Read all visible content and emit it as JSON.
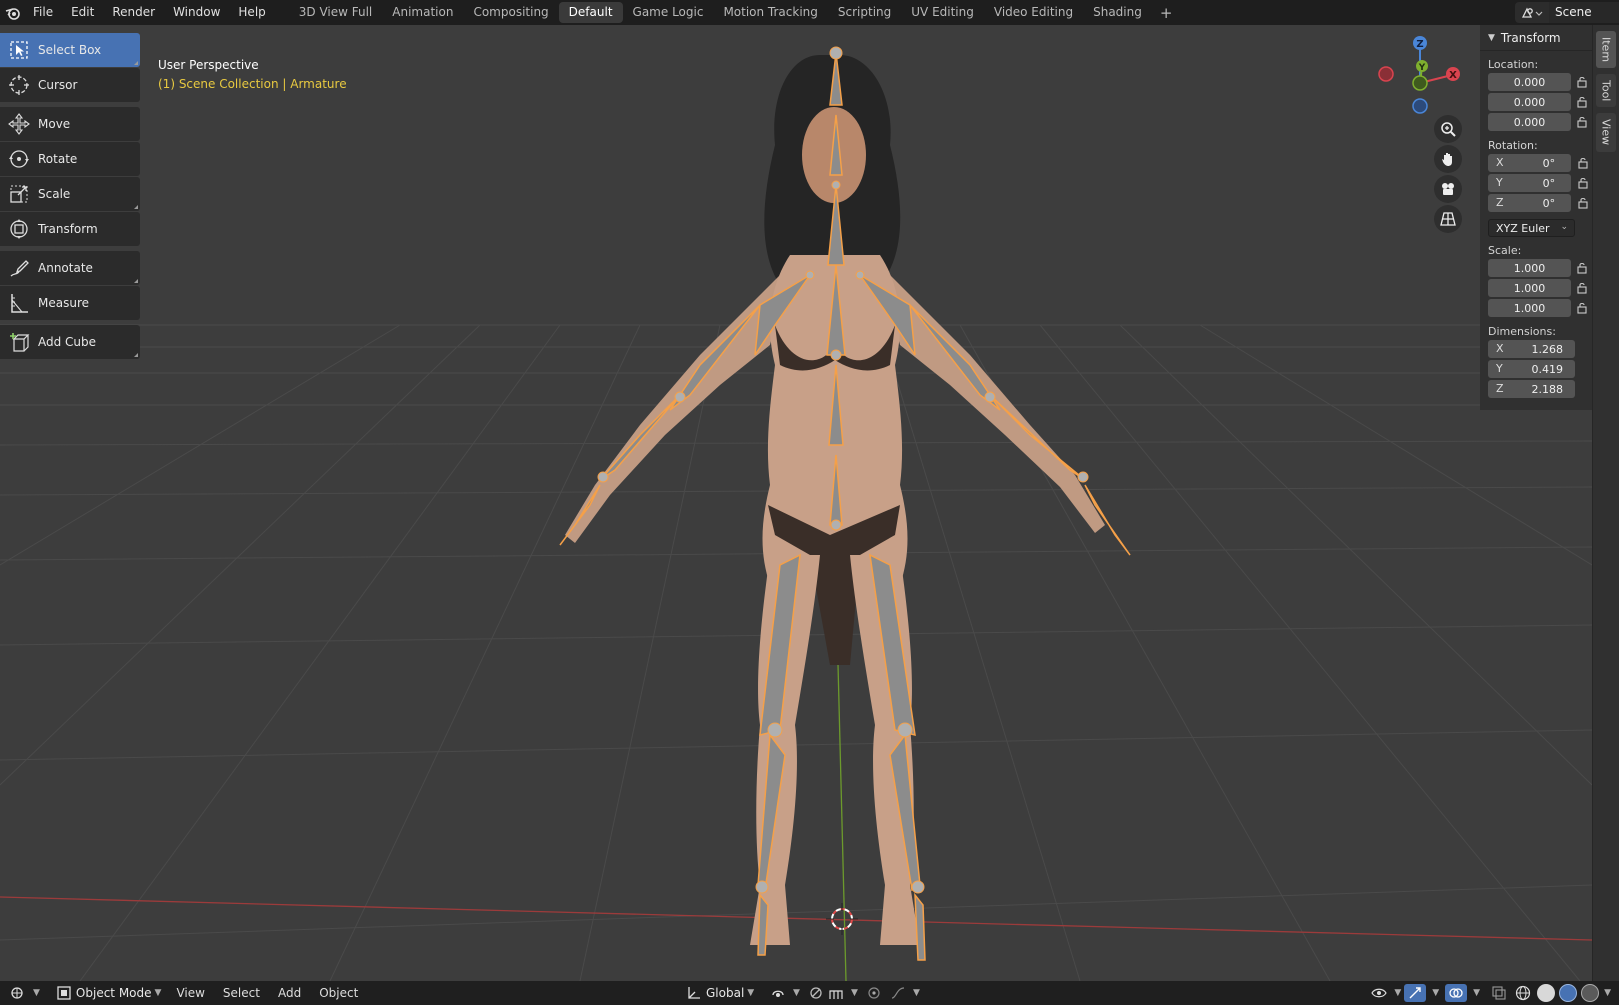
{
  "topbar": {
    "menus": [
      "File",
      "Edit",
      "Render",
      "Window",
      "Help"
    ],
    "workspaces": [
      "3D View Full",
      "Animation",
      "Compositing",
      "Default",
      "Game Logic",
      "Motion Tracking",
      "Scripting",
      "UV Editing",
      "Video Editing",
      "Shading"
    ],
    "active_workspace": "Default",
    "add_symbol": "+",
    "scene_name": "Scene"
  },
  "toolbar": {
    "tools": [
      {
        "label": "Select Box",
        "icon": "select-box-icon",
        "active": true
      },
      {
        "label": "Cursor",
        "icon": "cursor-icon"
      },
      {
        "label": "Move",
        "icon": "move-icon"
      },
      {
        "label": "Rotate",
        "icon": "rotate-icon"
      },
      {
        "label": "Scale",
        "icon": "scale-icon"
      },
      {
        "label": "Transform",
        "icon": "transform-icon"
      },
      {
        "label": "Annotate",
        "icon": "annotate-icon"
      },
      {
        "label": "Measure",
        "icon": "measure-icon"
      },
      {
        "label": "Add Cube",
        "icon": "add-cube-icon"
      }
    ]
  },
  "viewport": {
    "view_name": "User Perspective",
    "collection_line": "(1) Scene Collection | Armature",
    "gizmo_axes": {
      "z": "Z",
      "y": "Y",
      "x": "X"
    },
    "colors": {
      "x_axis": "#d9444f",
      "y_axis": "#7fb02e",
      "z_axis": "#4a86d8",
      "accent": "#4772b3",
      "bone_outline": "#f5a048",
      "collection_text": "#e8c940"
    }
  },
  "npanel": {
    "title": "Transform",
    "location_label": "Location:",
    "location": [
      "0.000",
      "0.000",
      "0.000"
    ],
    "rotation_label": "Rotation:",
    "rotation": [
      {
        "axis": "X",
        "value": "0°"
      },
      {
        "axis": "Y",
        "value": "0°"
      },
      {
        "axis": "Z",
        "value": "0°"
      }
    ],
    "rotation_mode": "XYZ Euler",
    "scale_label": "Scale:",
    "scale": [
      "1.000",
      "1.000",
      "1.000"
    ],
    "dimensions_label": "Dimensions:",
    "dimensions": [
      {
        "axis": "X",
        "value": "1.268"
      },
      {
        "axis": "Y",
        "value": "0.419"
      },
      {
        "axis": "Z",
        "value": "2.188"
      }
    ]
  },
  "sidetabs": [
    "Item",
    "Tool",
    "View"
  ],
  "bottombar": {
    "mode": "Object Mode",
    "menus": [
      "View",
      "Select",
      "Add",
      "Object"
    ],
    "orientation": "Global"
  }
}
